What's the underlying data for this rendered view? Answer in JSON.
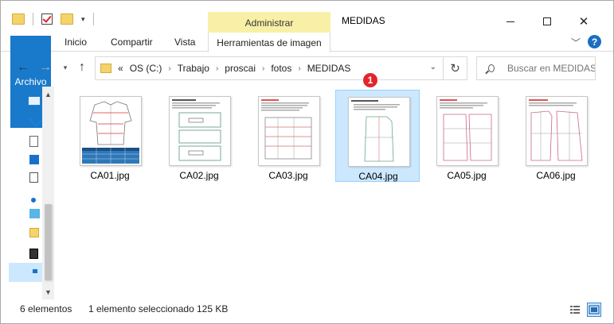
{
  "titlebar": {
    "title": "MEDIDAS",
    "context_tab": "Administrar",
    "minimize_icon": "minimize-icon",
    "maximize_icon": "maximize-icon",
    "close_icon": "close-icon"
  },
  "ribbon": {
    "tabs": [
      "Archivo",
      "Inicio",
      "Compartir",
      "Vista",
      "Herramientas de imagen"
    ],
    "expand_icon": "chevron-down-icon",
    "help_label": "?"
  },
  "nav": {
    "path_prefix": "«",
    "path": [
      "OS (C:)",
      "Trabajo",
      "proscai",
      "fotos",
      "MEDIDAS"
    ],
    "search_placeholder": "Buscar en MEDIDAS"
  },
  "files": [
    {
      "name": "CA01.jpg",
      "selected": false
    },
    {
      "name": "CA02.jpg",
      "selected": false
    },
    {
      "name": "CA03.jpg",
      "selected": false
    },
    {
      "name": "CA04.jpg",
      "selected": true
    },
    {
      "name": "CA05.jpg",
      "selected": false
    },
    {
      "name": "CA06.jpg",
      "selected": false
    }
  ],
  "annotation": {
    "badge": "1"
  },
  "status": {
    "count": "6 elementos",
    "selection": "1 elemento seleccionado",
    "size": "125 KB"
  },
  "colors": {
    "file_tab": "#1979ca",
    "context_tab": "#f8f0a6",
    "selection": "#cce8ff",
    "badge": "#e2252b"
  }
}
